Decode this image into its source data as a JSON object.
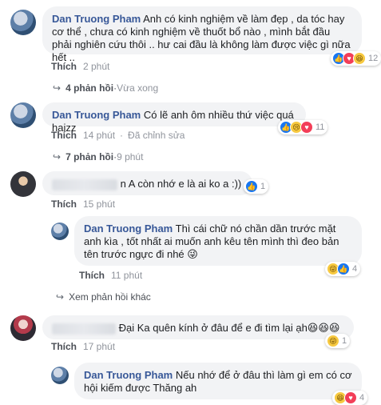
{
  "comments": [
    {
      "author": "Dan Truong Pham",
      "text": "Anh có kinh nghiệm về làm đẹp , da tóc hay cơ thể , chưa có kinh nghiệm về thuốt bổ nào , mình bắt đầu phải nghiên cứu thôi .. hư cai đầu là không làm được việc gì nữa hết ..",
      "like_label": "Thích",
      "time": "2 phút",
      "reaction_count": "12",
      "replies_label": "4 phản hồi",
      "replies_time": "Vừa xong"
    },
    {
      "author": "Dan Truong Pham",
      "text": "Có lẽ anh ôm nhiều thứ việc quá haizz",
      "like_label": "Thích",
      "time": "14 phút",
      "edited": "Đã chỉnh sửa",
      "reaction_count": "11",
      "replies_label": "7 phản hồi",
      "replies_time": "9 phút"
    },
    {
      "author": "",
      "text": "n A còn nhớ e là ai ko a :))",
      "like_label": "Thích",
      "time": "15 phút",
      "reaction_count": "1"
    },
    {
      "author": "Dan Truong Pham",
      "text": "Thì cái chữ nó chần dần trước mặt anh kìa , tốt nhất ai muốn anh kêu tên mình thì đeo bản tên trước ngực đi nhé",
      "emoji": "😜",
      "like_label": "Thích",
      "time": "11 phút",
      "reaction_count": "4"
    },
    {
      "more_replies": "Xem phản hồi khác"
    },
    {
      "author": "",
      "text": "Đại Ka quên kính ở đâu để e đi tìm lại ạh",
      "emoji": "😆😆😆",
      "like_label": "Thích",
      "time": "17 phút",
      "reaction_count": "1"
    },
    {
      "author": "Dan Truong Pham",
      "text": "Nếu nhớ để ở đâu thì làm gì em có cơ hội kiếm được Thăng ah",
      "reaction_count": "4"
    }
  ],
  "colors": {
    "name": "#385898",
    "bubble": "#f2f3f5",
    "meta": "#90949c",
    "like_reaction": "#1877f2",
    "love_reaction": "#f33e58"
  }
}
